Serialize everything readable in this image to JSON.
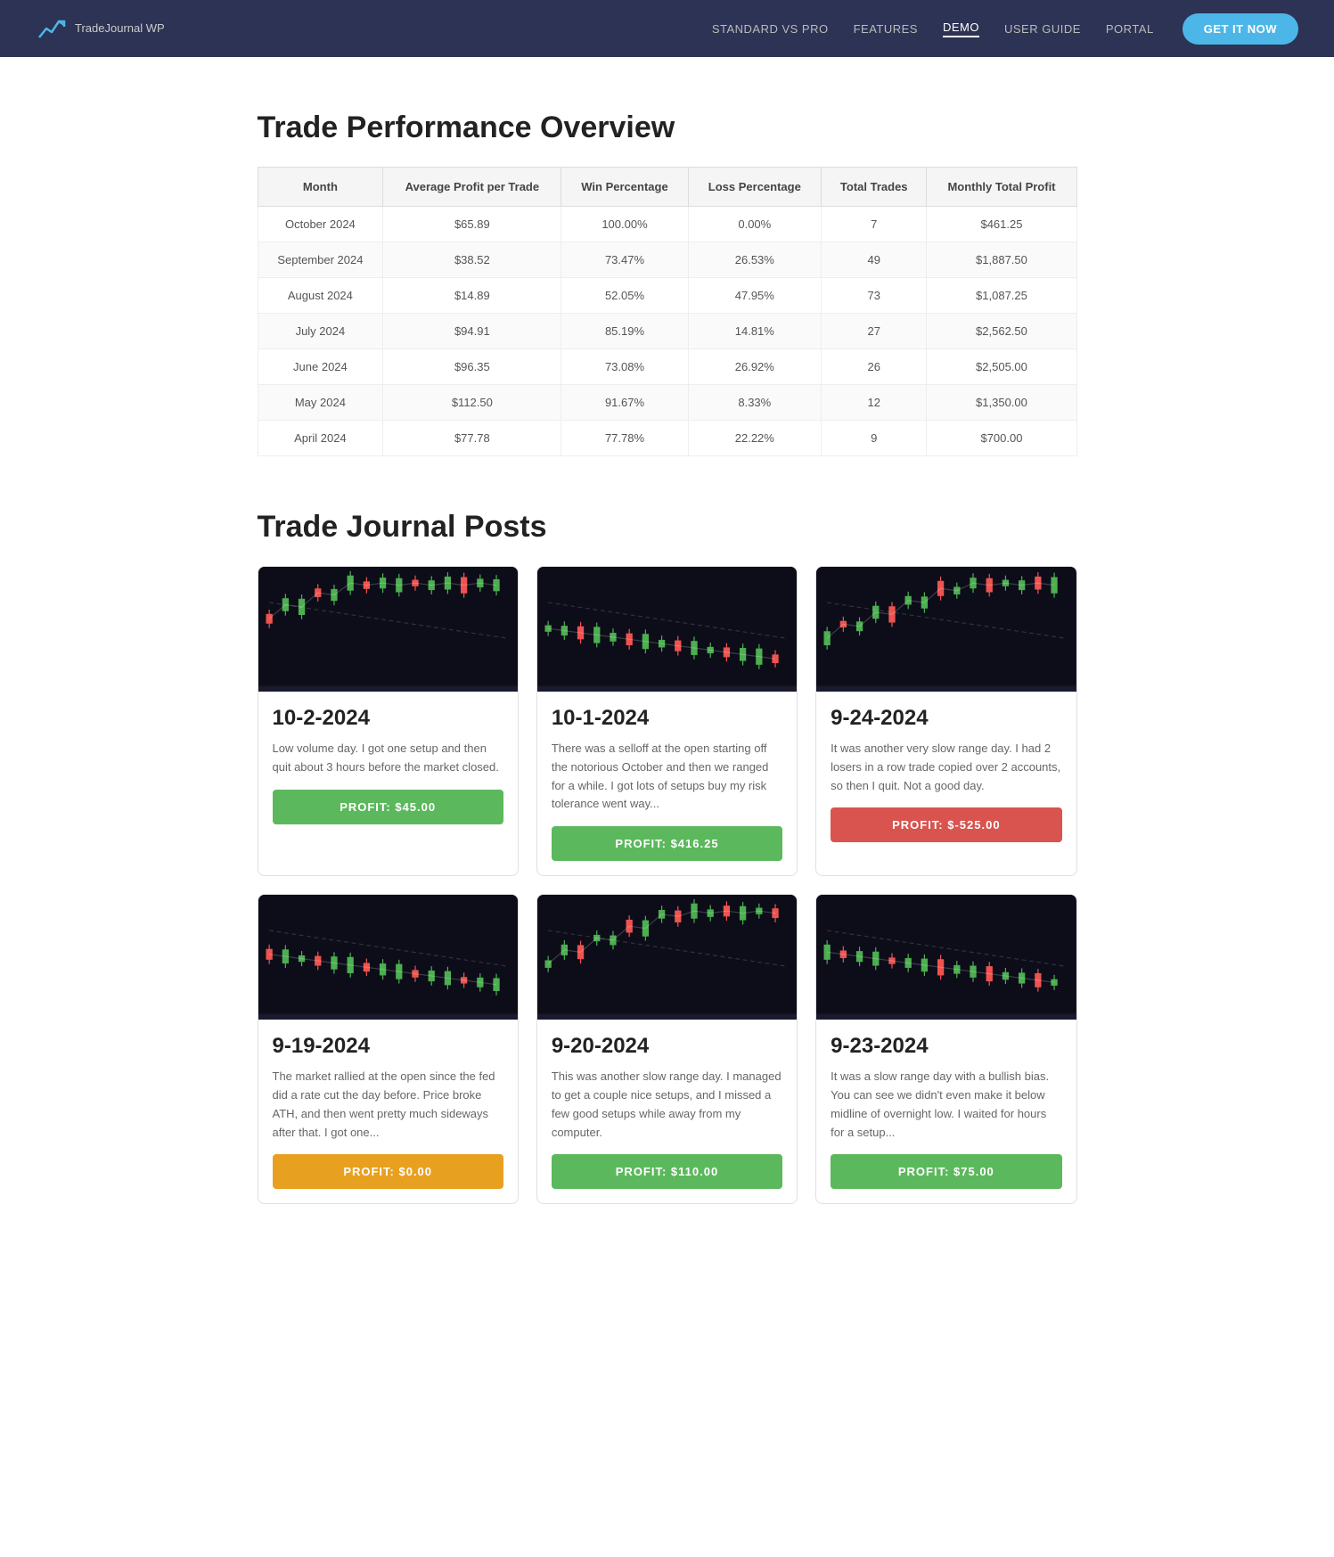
{
  "nav": {
    "logo_text": "TradeJournal WP",
    "links": [
      {
        "label": "STANDARD VS PRO",
        "active": false
      },
      {
        "label": "FEATURES",
        "active": false
      },
      {
        "label": "DEMO",
        "active": true
      },
      {
        "label": "USER GUIDE",
        "active": false
      },
      {
        "label": "PORTAL",
        "active": false
      }
    ],
    "cta_label": "GET IT NOW"
  },
  "performance": {
    "title": "Trade Performance Overview",
    "columns": [
      "Month",
      "Average Profit per Trade",
      "Win Percentage",
      "Loss Percentage",
      "Total Trades",
      "Monthly Total Profit"
    ],
    "rows": [
      {
        "month": "October 2024",
        "avg_profit": "$65.89",
        "win_pct": "100.00%",
        "loss_pct": "0.00%",
        "total_trades": "7",
        "monthly_profit": "$461.25"
      },
      {
        "month": "September 2024",
        "avg_profit": "$38.52",
        "win_pct": "73.47%",
        "loss_pct": "26.53%",
        "total_trades": "49",
        "monthly_profit": "$1,887.50"
      },
      {
        "month": "August 2024",
        "avg_profit": "$14.89",
        "win_pct": "52.05%",
        "loss_pct": "47.95%",
        "total_trades": "73",
        "monthly_profit": "$1,087.25"
      },
      {
        "month": "July 2024",
        "avg_profit": "$94.91",
        "win_pct": "85.19%",
        "loss_pct": "14.81%",
        "total_trades": "27",
        "monthly_profit": "$2,562.50"
      },
      {
        "month": "June 2024",
        "avg_profit": "$96.35",
        "win_pct": "73.08%",
        "loss_pct": "26.92%",
        "total_trades": "26",
        "monthly_profit": "$2,505.00"
      },
      {
        "month": "May 2024",
        "avg_profit": "$112.50",
        "win_pct": "91.67%",
        "loss_pct": "8.33%",
        "total_trades": "12",
        "monthly_profit": "$1,350.00"
      },
      {
        "month": "April 2024",
        "avg_profit": "$77.78",
        "win_pct": "77.78%",
        "loss_pct": "22.22%",
        "total_trades": "9",
        "monthly_profit": "$700.00"
      }
    ]
  },
  "journal": {
    "title": "Trade Journal Posts",
    "posts": [
      {
        "date": "10-2-2024",
        "excerpt": "Low volume day.  I got one setup and then quit about 3 hours before the market closed.",
        "profit_label": "PROFIT: $45.00",
        "profit_type": "positive"
      },
      {
        "date": "10-1-2024",
        "excerpt": "There was a selloff at the open starting off the notorious October and then we ranged for a while.  I got lots of setups buy my risk tolerance went way...",
        "profit_label": "PROFIT: $416.25",
        "profit_type": "positive"
      },
      {
        "date": "9-24-2024",
        "excerpt": "It was another very slow range day.  I had 2 losers in a row trade copied over 2 accounts, so then I quit.  Not a good day.",
        "profit_label": "PROFIT: $-525.00",
        "profit_type": "negative"
      },
      {
        "date": "9-19-2024",
        "excerpt": "The market rallied at the open since the fed did a rate cut the day before.  Price broke ATH, and then went pretty much sideways after that.  I got one...",
        "profit_label": "PROFIT: $0.00",
        "profit_type": "zero"
      },
      {
        "date": "9-20-2024",
        "excerpt": "This was another slow range day.  I managed to get a couple nice setups, and I missed a few good setups while away from my computer.",
        "profit_label": "PROFIT: $110.00",
        "profit_type": "positive"
      },
      {
        "date": "9-23-2024",
        "excerpt": "It was a slow range day with a bullish bias.  You can see we didn't even make it below midline of overnight low.  I waited for hours for a setup...",
        "profit_label": "PROFIT: $75.00",
        "profit_type": "positive"
      }
    ]
  }
}
